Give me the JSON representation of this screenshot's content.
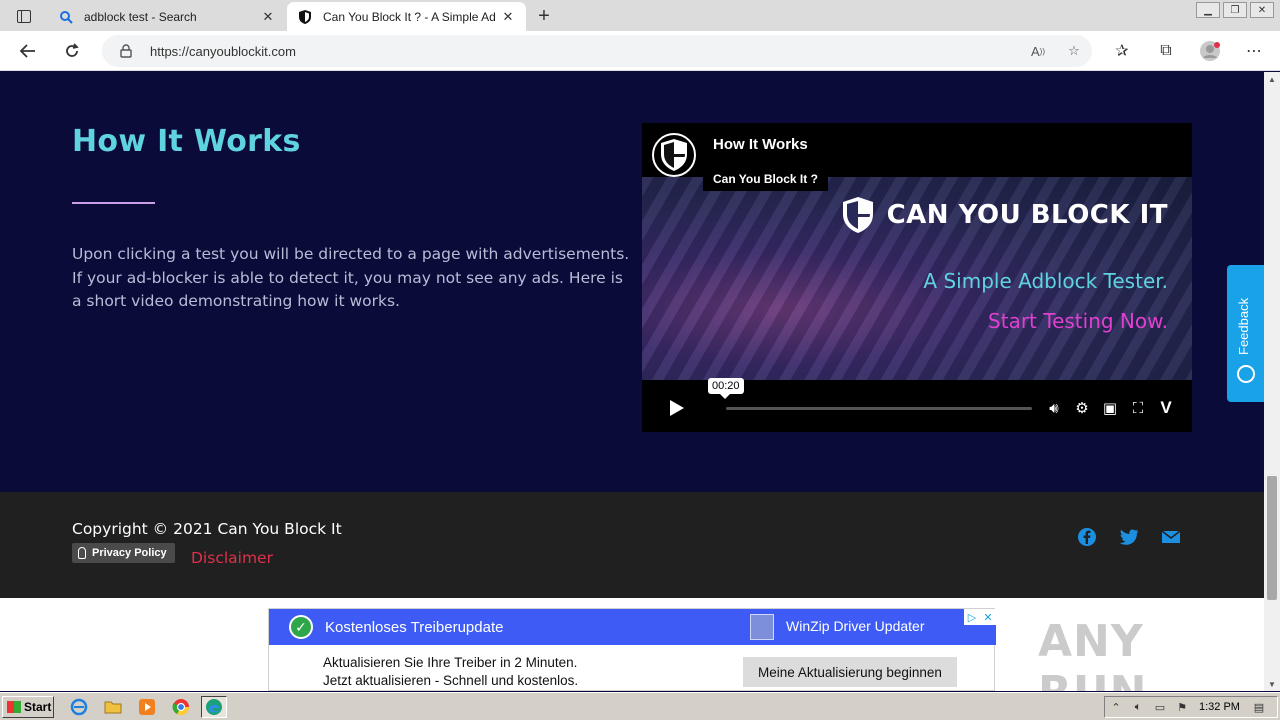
{
  "browser": {
    "tabs": [
      {
        "title": "adblock test - Search",
        "icon": "search-icon"
      },
      {
        "title": "Can You Block It ? - A Simple Ad",
        "icon": "shield-icon"
      }
    ],
    "address_url": "https://canyoublockit.com"
  },
  "how": {
    "title": "How It Works",
    "description": "Upon clicking a test you will be directed to a page with advertisements. If your ad-blocker is able to detect it, you may not see any ads. Here is a short video demonstrating how it works."
  },
  "video": {
    "title": "How It Works",
    "channel": "Can You Block It ?",
    "brand": "CAN YOU BLOCK IT",
    "line1": "A Simple Adblock Tester.",
    "line2": "Start Testing Now.",
    "time": "00:20",
    "colors": {
      "accent_cyan": "#5fd3e0",
      "accent_pink": "#e040d0"
    }
  },
  "footer": {
    "copyright": "Copyright © 2021 Can You Block It",
    "privacy": "Privacy Policy",
    "disclaimer": "Disclaimer",
    "social": [
      "facebook-icon",
      "twitter-icon",
      "mail-icon"
    ]
  },
  "ad": {
    "headline": "Kostenloses Treiberupdate",
    "brand": "WinZip Driver Updater",
    "body_line1": "Aktualisieren Sie Ihre Treiber in 2 Minuten.",
    "body_line2": "Jetzt aktualisieren - Schnell und kostenlos.",
    "cta": "Meine Aktualisierung beginnen"
  },
  "feedback_label": "Feedback",
  "watermark": "ANY RUN",
  "taskbar": {
    "start_label": "Start",
    "clock": "1:32 PM"
  }
}
